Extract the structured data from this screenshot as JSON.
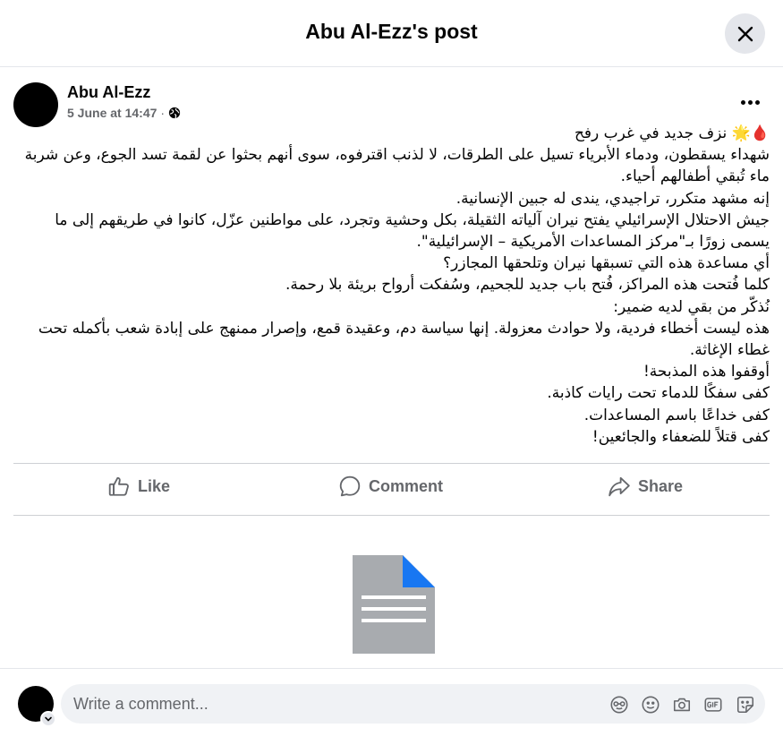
{
  "header": {
    "title": "Abu Al-Ezz's post"
  },
  "post": {
    "author": "Abu Al-Ezz",
    "timestamp": "5 June at 14:47",
    "separator": "·",
    "lines": [
      "🩸🌟 نزف جديد في غرب رفح",
      "شهداء يسقطون، ودماء الأبرياء تسيل على الطرقات، لا لذنب اقترفوه، سوى أنهم بحثوا عن لقمة تسد الجوع، وعن شربة ماء تُبقي أطفالهم أحياء.",
      "إنه مشهد متكرر، تراجيدي، يندى له جبين الإنسانية.",
      "جيش الاحتلال الإسرائيلي يفتح نيران آلياته الثقيلة، بكل وحشية وتجرد، على مواطنين عزّل، كانوا في طريقهم إلى ما يسمى زورًا بـ\"مركز المساعدات الأمريكية – الإسرائيلية\".",
      "أي مساعدة هذه التي تسبقها نيران وتلحقها المجازر؟",
      "كلما فُتحت هذه المراكز، فُتح باب جديد للجحيم، وسُفكت أرواح بريئة بلا رحمة.",
      "نُذكّر من بقي لديه ضمير:",
      "هذه ليست أخطاء فردية، ولا حوادث معزولة. إنها سياسة دم، وعقيدة قمع، وإصرار ممنهج على إبادة شعب بأكمله تحت غطاء الإغاثة.",
      "أوقفوا هذه المذبحة!",
      "كفى سفكًا للدماء تحت رايات كاذبة.",
      "كفى خداعًا باسم المساعدات.",
      "كفى قتلاً للضعفاء والجائعين!"
    ]
  },
  "actions": {
    "like": "Like",
    "comment": "Comment",
    "share": "Share"
  },
  "comment_box": {
    "placeholder": "Write a comment..."
  },
  "colors": {
    "text": "#050505",
    "secondary": "#65676b",
    "input_bg": "#f0f2f5",
    "doc_blue": "#1877f2",
    "doc_gray": "#a8abaf"
  },
  "icons": {
    "close": "close-icon",
    "more": "more-options-icon",
    "privacy": "globe-icon",
    "like": "thumbs-up-icon",
    "comment": "comment-bubble-icon",
    "share": "share-arrow-icon",
    "attachment": "document-icon",
    "avatar_chevron": "chevron-down-icon",
    "comment_tools": [
      "avatar-sticker-icon",
      "emoji-icon",
      "camera-icon",
      "gif-icon",
      "sticker-icon"
    ]
  }
}
